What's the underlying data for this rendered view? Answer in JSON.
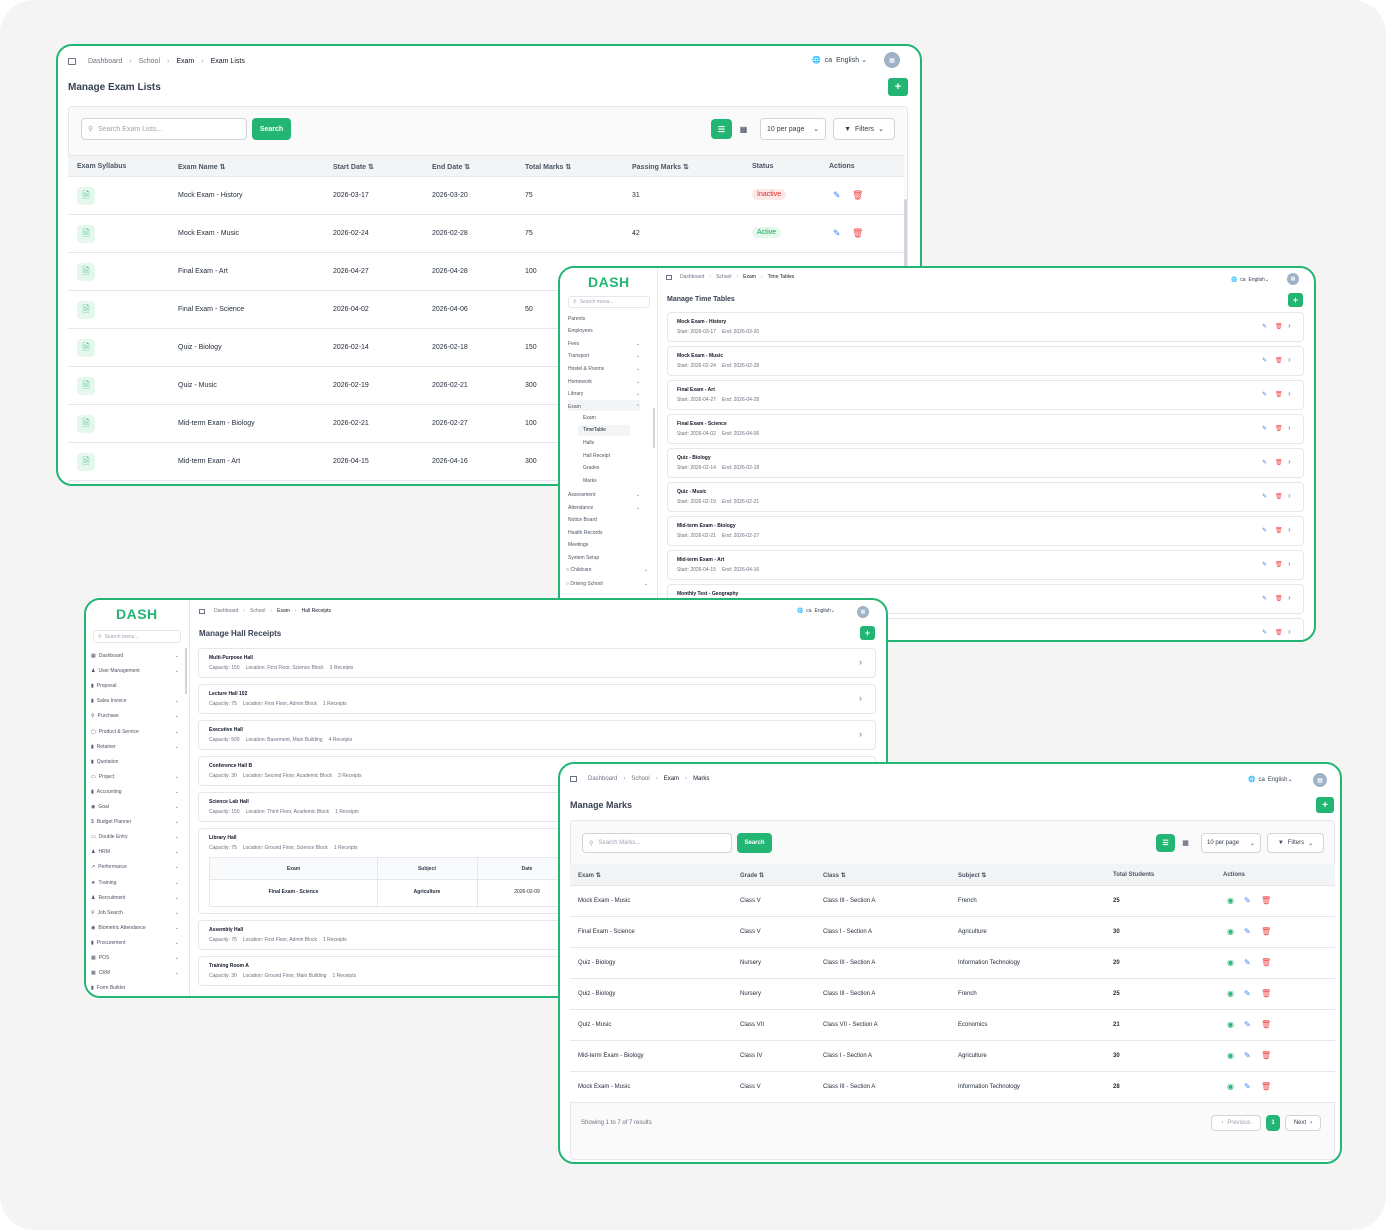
{
  "w1": {
    "breadcrumb": [
      "Dashboard",
      "School",
      "Exam",
      "Exam Lists"
    ],
    "lang_code": "ca",
    "lang": "English",
    "title": "Manage Exam Lists",
    "search_placeholder": "Search Exam Lists...",
    "search_btn": "Search",
    "per_page": "10 per page",
    "filters": "Filters",
    "columns": [
      "Exam Syllabus",
      "Exam Name",
      "Start Date",
      "End Date",
      "Total Marks",
      "Passing Marks",
      "Status",
      "Actions"
    ],
    "rows": [
      {
        "name": "Mock Exam - History",
        "start": "2026-03-17",
        "end": "2026-03-20",
        "total": "75",
        "pass": "31",
        "status": "Inactive"
      },
      {
        "name": "Mock Exam - Music",
        "start": "2026-02-24",
        "end": "2026-02-28",
        "total": "75",
        "pass": "42",
        "status": "Active"
      },
      {
        "name": "Final Exam - Art",
        "start": "2026-04-27",
        "end": "2026-04-28",
        "total": "100",
        "pass": "",
        "status": ""
      },
      {
        "name": "Final Exam - Science",
        "start": "2026-04-02",
        "end": "2026-04-06",
        "total": "50",
        "pass": "",
        "status": ""
      },
      {
        "name": "Quiz - Biology",
        "start": "2026-02-14",
        "end": "2026-02-18",
        "total": "150",
        "pass": "",
        "status": ""
      },
      {
        "name": "Quiz - Music",
        "start": "2026-02-19",
        "end": "2026-02-21",
        "total": "300",
        "pass": "",
        "status": ""
      },
      {
        "name": "Mid-term Exam - Biology",
        "start": "2026-02-21",
        "end": "2026-02-27",
        "total": "100",
        "pass": "",
        "status": ""
      },
      {
        "name": "Mid-term Exam - Art",
        "start": "2026-04-15",
        "end": "2026-04-16",
        "total": "300",
        "pass": "",
        "status": ""
      }
    ]
  },
  "w2": {
    "logo": "DASH",
    "search_menu": "Search menu...",
    "breadcrumb": [
      "Dashboard",
      "School",
      "Exam",
      "Time Tables"
    ],
    "lang_code": "ca",
    "lang": "English",
    "title": "Manage Time Tables",
    "menu": [
      {
        "label": "Parents",
        "sub": false,
        "chev": false
      },
      {
        "label": "Employees",
        "sub": false,
        "chev": false
      },
      {
        "label": "Fees",
        "sub": false,
        "chev": true
      },
      {
        "label": "Transport",
        "sub": false,
        "chev": true
      },
      {
        "label": "Hostel & Rooms",
        "sub": false,
        "chev": true
      },
      {
        "label": "Homework",
        "sub": false,
        "chev": true
      },
      {
        "label": "Library",
        "sub": false,
        "chev": true
      },
      {
        "label": "Exam",
        "sub": false,
        "chev": true,
        "open": true
      },
      {
        "label": "Exam",
        "sub": true
      },
      {
        "label": "TimeTable",
        "sub": true,
        "active": true
      },
      {
        "label": "Halls",
        "sub": true
      },
      {
        "label": "Hall Receipt",
        "sub": true
      },
      {
        "label": "Grades",
        "sub": true
      },
      {
        "label": "Marks",
        "sub": true
      },
      {
        "label": "Assessment",
        "sub": false,
        "chev": true
      },
      {
        "label": "Attendance",
        "sub": false,
        "chev": true
      },
      {
        "label": "Notice Board",
        "sub": false,
        "chev": false
      },
      {
        "label": "Health Records",
        "sub": false,
        "chev": false
      },
      {
        "label": "Meetings",
        "sub": false,
        "chev": false
      },
      {
        "label": "System Setup",
        "sub": false,
        "chev": false
      }
    ],
    "menu_bottom": [
      "Childcare",
      "Driving School"
    ],
    "items": [
      {
        "t": "Mock Exam - History",
        "start": "2026-03-17",
        "end": "2026-03-20"
      },
      {
        "t": "Mock Exam - Music",
        "start": "2026-02-24",
        "end": "2026-02-28"
      },
      {
        "t": "Final Exam - Art",
        "start": "2026-04-27",
        "end": "2026-04-28"
      },
      {
        "t": "Final Exam - Science",
        "start": "2026-04-02",
        "end": "2026-04-06"
      },
      {
        "t": "Quiz - Biology",
        "start": "2026-02-14",
        "end": "2026-02-18"
      },
      {
        "t": "Quiz - Music",
        "start": "2026-02-19",
        "end": "2026-02-21"
      },
      {
        "t": "Mid-term Exam - Biology",
        "start": "2026-02-21",
        "end": "2026-02-27"
      },
      {
        "t": "Mid-term Exam - Art",
        "start": "2026-04-15",
        "end": "2026-04-16"
      },
      {
        "t": "Monthly Test - Geography",
        "start": "",
        "end": ""
      }
    ],
    "start_label": "Start:",
    "end_label": "End:"
  },
  "w3": {
    "logo": "DASH",
    "search_menu": "Search menu...",
    "breadcrumb": [
      "Dashboard",
      "School",
      "Exam",
      "Hall Receipts"
    ],
    "lang_code": "ca",
    "lang": "English",
    "title": "Manage Hall Receipts",
    "menu": [
      "Dashboard",
      "User Management",
      "Proposal",
      "Sales Invoice",
      "Purchase",
      "Product & Service",
      "Retainer",
      "Quotation",
      "Project",
      "Accounting",
      "Goal",
      "Budget Planner",
      "Double Entry",
      "HRM",
      "Performance",
      "Training",
      "Recruitment",
      "Job Search",
      "Biometric Attendance",
      "Procurement",
      "POS",
      "CRM",
      "Form Builder"
    ],
    "menu_icons": [
      "grid-icon",
      "users-icon",
      "file-icon",
      "invoice-icon",
      "cart-icon",
      "box-icon",
      "file-icon",
      "file-icon",
      "folder-icon",
      "calc-icon",
      "target-icon",
      "dollar-icon",
      "book-icon",
      "hrm-icon",
      "chart-icon",
      "training-icon",
      "recruit-icon",
      "search-icon",
      "fingerprint-icon",
      "procure-icon",
      "pos-icon",
      "crm-icon",
      "form-icon"
    ],
    "menu_chev": [
      true,
      true,
      false,
      true,
      true,
      true,
      true,
      false,
      true,
      true,
      true,
      true,
      true,
      true,
      true,
      true,
      true,
      true,
      true,
      true,
      true,
      true,
      false
    ],
    "halls": [
      {
        "t": "Multi-Purpose Hall",
        "cap": "150",
        "loc": "First Floor, Science Block",
        "rec": "3 Receipts"
      },
      {
        "t": "Lecture Hall 102",
        "cap": "75",
        "loc": "First Floor, Admin Block",
        "rec": "1 Receipts"
      },
      {
        "t": "Executive Hall",
        "cap": "500",
        "loc": "Basement, Main Building",
        "rec": "4 Receipts"
      },
      {
        "t": "Conference Hall B",
        "cap": "30",
        "loc": "Second Floor, Academic Block",
        "rec": "3 Receipts"
      },
      {
        "t": "Science Lab Hall",
        "cap": "150",
        "loc": "Third Floor, Academic Block",
        "rec": "1 Receipts"
      },
      {
        "t": "Library Hall",
        "cap": "75",
        "loc": "Ground Floor, Science Block",
        "rec": "1 Receipts"
      },
      {
        "t": "Assembly Hall",
        "cap": "75",
        "loc": "First Floor, Admin Block",
        "rec": "1 Receipts"
      },
      {
        "t": "Training Room A",
        "cap": "30",
        "loc": "Ground Floor, Main Building",
        "rec": "1 Receipts"
      }
    ],
    "cap_label": "Capacity:",
    "loc_label": "Location:",
    "sub_cols": [
      "Exam",
      "Subject",
      "Date"
    ],
    "sub_row": [
      "Final Exam - Science",
      "Agriculture",
      "2026-02-09"
    ]
  },
  "w4": {
    "breadcrumb": [
      "Dashboard",
      "School",
      "Exam",
      "Marks"
    ],
    "lang_code": "ca",
    "lang": "English",
    "title": "Manage Marks",
    "search_placeholder": "Search Marks...",
    "search_btn": "Search",
    "per_page": "10 per page",
    "filters": "Filters",
    "columns": [
      "Exam",
      "Grade",
      "Class",
      "Subject",
      "Total Students",
      "Actions"
    ],
    "rows": [
      [
        "Mock Exam - Music",
        "Class V",
        "Class III - Section A",
        "French",
        "25"
      ],
      [
        "Final Exam - Science",
        "Class V",
        "Class I - Section A",
        "Agriculture",
        "30"
      ],
      [
        "Quiz - Biology",
        "Nursery",
        "Class III - Section A",
        "Information Technology",
        "20"
      ],
      [
        "Quiz - Biology",
        "Nursery",
        "Class III - Section A",
        "French",
        "25"
      ],
      [
        "Quiz - Music",
        "Class VII",
        "Class VII - Section A",
        "Economics",
        "21"
      ],
      [
        "Mid-term Exam - Biology",
        "Class IV",
        "Class I - Section A",
        "Agriculture",
        "30"
      ],
      [
        "Mock Exam - Music",
        "Class V",
        "Class III - Section A",
        "Information Technology",
        "28"
      ]
    ],
    "showing": "Showing 1 to 7 of 7 results",
    "prev": "Previous",
    "page": "1",
    "next": "Next"
  }
}
